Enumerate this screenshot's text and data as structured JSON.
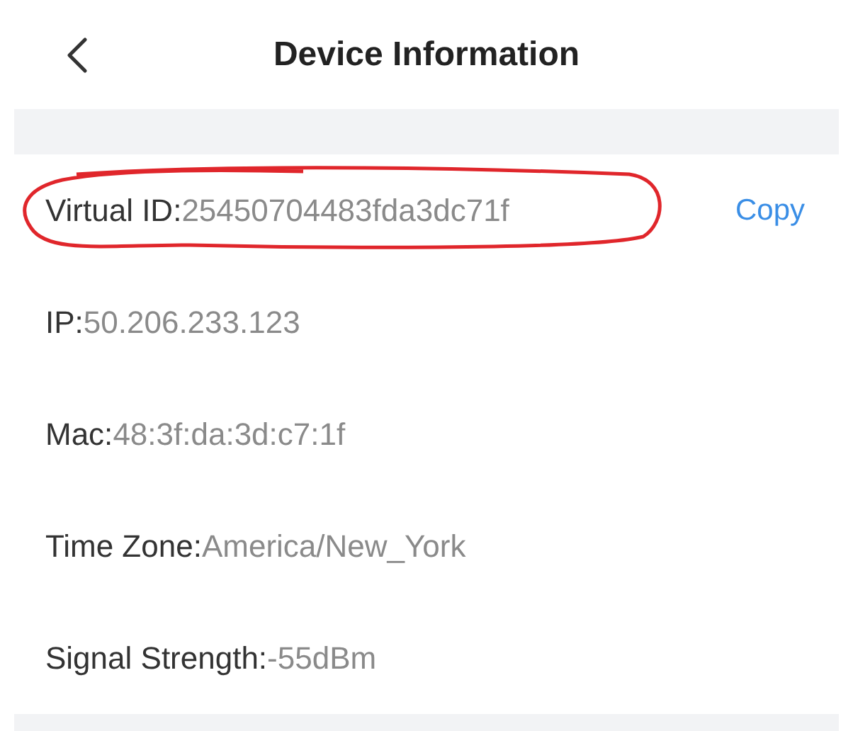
{
  "header": {
    "title": "Device Information"
  },
  "rows": [
    {
      "label": "Virtual ID:",
      "value": "25450704483fda3dc71f",
      "action": "Copy",
      "circled": true
    },
    {
      "label": "IP:",
      "value": "50.206.233.123",
      "circled": false
    },
    {
      "label": "Mac:",
      "value": "48:3f:da:3d:c7:1f",
      "circled": false
    },
    {
      "label": "Time Zone:",
      "value": "America/New_York",
      "circled": false
    },
    {
      "label": "Signal Strength:",
      "value": "-55dBm",
      "circled": false
    }
  ]
}
